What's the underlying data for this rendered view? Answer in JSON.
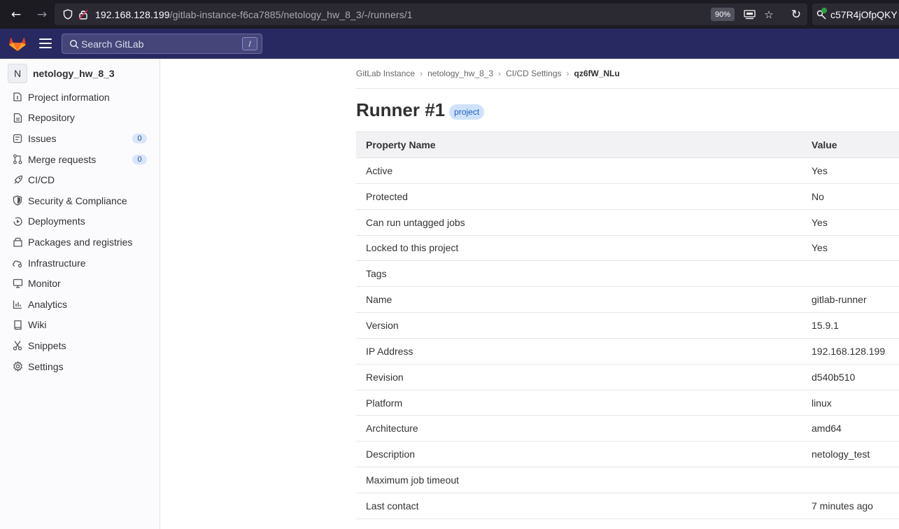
{
  "browser": {
    "url_host": "192.168.128.199",
    "url_path": "/gitlab-instance-f6ca7885/netology_hw_8_3/-/runners/1",
    "zoom": "90%",
    "extension_text": "c57R4jOfpQKY"
  },
  "gitlab_topbar": {
    "search_placeholder": "Search GitLab",
    "search_shortcut": "/"
  },
  "sidebar": {
    "project_avatar_letter": "N",
    "project_name": "netology_hw_8_3",
    "items": [
      {
        "label": "Project information",
        "icon": "info-icon"
      },
      {
        "label": "Repository",
        "icon": "document-icon"
      },
      {
        "label": "Issues",
        "icon": "issues-icon",
        "badge": "0"
      },
      {
        "label": "Merge requests",
        "icon": "merge-request-icon",
        "badge": "0"
      },
      {
        "label": "CI/CD",
        "icon": "rocket-icon"
      },
      {
        "label": "Security & Compliance",
        "icon": "shield-icon"
      },
      {
        "label": "Deployments",
        "icon": "deployments-icon"
      },
      {
        "label": "Packages and registries",
        "icon": "package-icon"
      },
      {
        "label": "Infrastructure",
        "icon": "cloud-gear-icon"
      },
      {
        "label": "Monitor",
        "icon": "monitor-icon"
      },
      {
        "label": "Analytics",
        "icon": "chart-icon"
      },
      {
        "label": "Wiki",
        "icon": "book-icon"
      },
      {
        "label": "Snippets",
        "icon": "scissors-icon"
      },
      {
        "label": "Settings",
        "icon": "gear-icon"
      }
    ]
  },
  "breadcrumbs": [
    "GitLab Instance",
    "netology_hw_8_3",
    "CI/CD Settings",
    "qz6fW_NLu"
  ],
  "page": {
    "title": "Runner #1",
    "badge": "project"
  },
  "table": {
    "headers": [
      "Property Name",
      "Value"
    ],
    "rows": [
      {
        "name": "Active",
        "value": "Yes"
      },
      {
        "name": "Protected",
        "value": "No"
      },
      {
        "name": "Can run untagged jobs",
        "value": "Yes"
      },
      {
        "name": "Locked to this project",
        "value": "Yes"
      },
      {
        "name": "Tags",
        "value": ""
      },
      {
        "name": "Name",
        "value": "gitlab-runner"
      },
      {
        "name": "Version",
        "value": "15.9.1"
      },
      {
        "name": "IP Address",
        "value": "192.168.128.199"
      },
      {
        "name": "Revision",
        "value": "d540b510"
      },
      {
        "name": "Platform",
        "value": "linux"
      },
      {
        "name": "Architecture",
        "value": "amd64"
      },
      {
        "name": "Description",
        "value": "netology_test"
      },
      {
        "name": "Maximum job timeout",
        "value": ""
      },
      {
        "name": "Last contact",
        "value": "7 minutes ago"
      }
    ]
  },
  "colors": {
    "gitlab_topbar": "#292961",
    "browser_bar": "#1c1b22",
    "badge_blue": "#cfe2fa"
  }
}
